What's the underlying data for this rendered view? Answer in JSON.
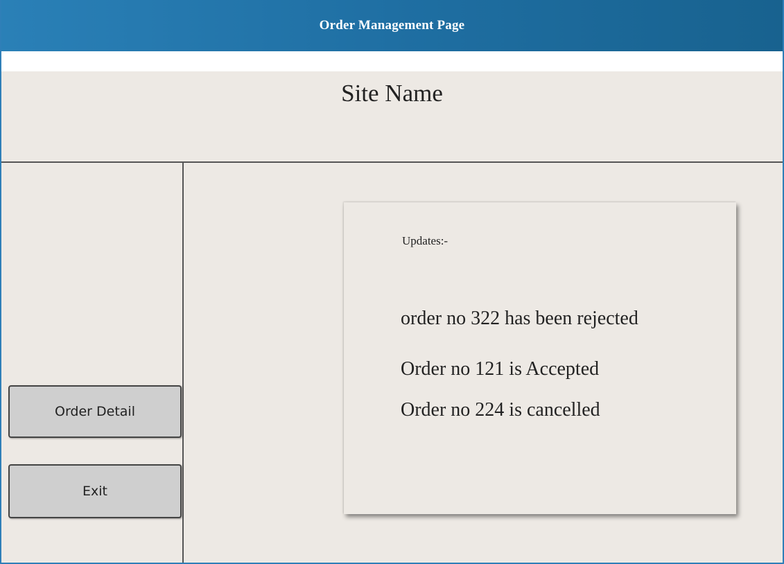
{
  "window": {
    "title": "Order Management Page"
  },
  "header": {
    "site_name": "Site Name"
  },
  "sidebar": {
    "buttons": [
      {
        "label": "Order Detail"
      },
      {
        "label": "Exit"
      }
    ]
  },
  "updates": {
    "heading": "Updates:-",
    "items": [
      "order no 322 has been rejected",
      "Order no 121 is Accepted",
      "Order no 224 is cancelled"
    ]
  },
  "colors": {
    "titlebar": "#1f6fa3",
    "background": "#ede9e4",
    "button": "#cfcfcf"
  }
}
